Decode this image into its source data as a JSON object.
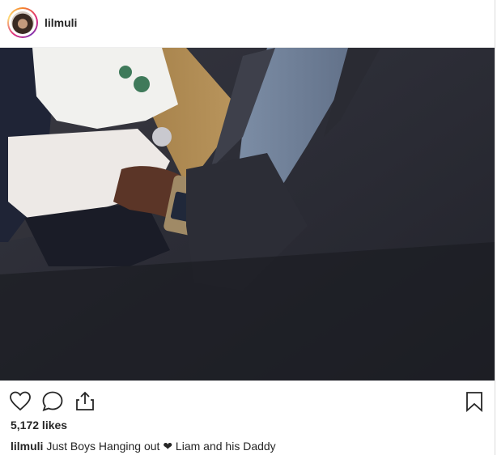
{
  "post": {
    "username": "lilmuli",
    "likes": "5,172 likes",
    "caption_user": "lilmuli",
    "caption_text": "Just Boys Hanging out ❤ Liam and his Daddy"
  },
  "icons": {
    "like": "heart-icon",
    "comment": "comment-icon",
    "share": "share-icon",
    "save": "bookmark-icon"
  },
  "colors": {
    "text": "#262626",
    "border": "#dbdbdb"
  }
}
